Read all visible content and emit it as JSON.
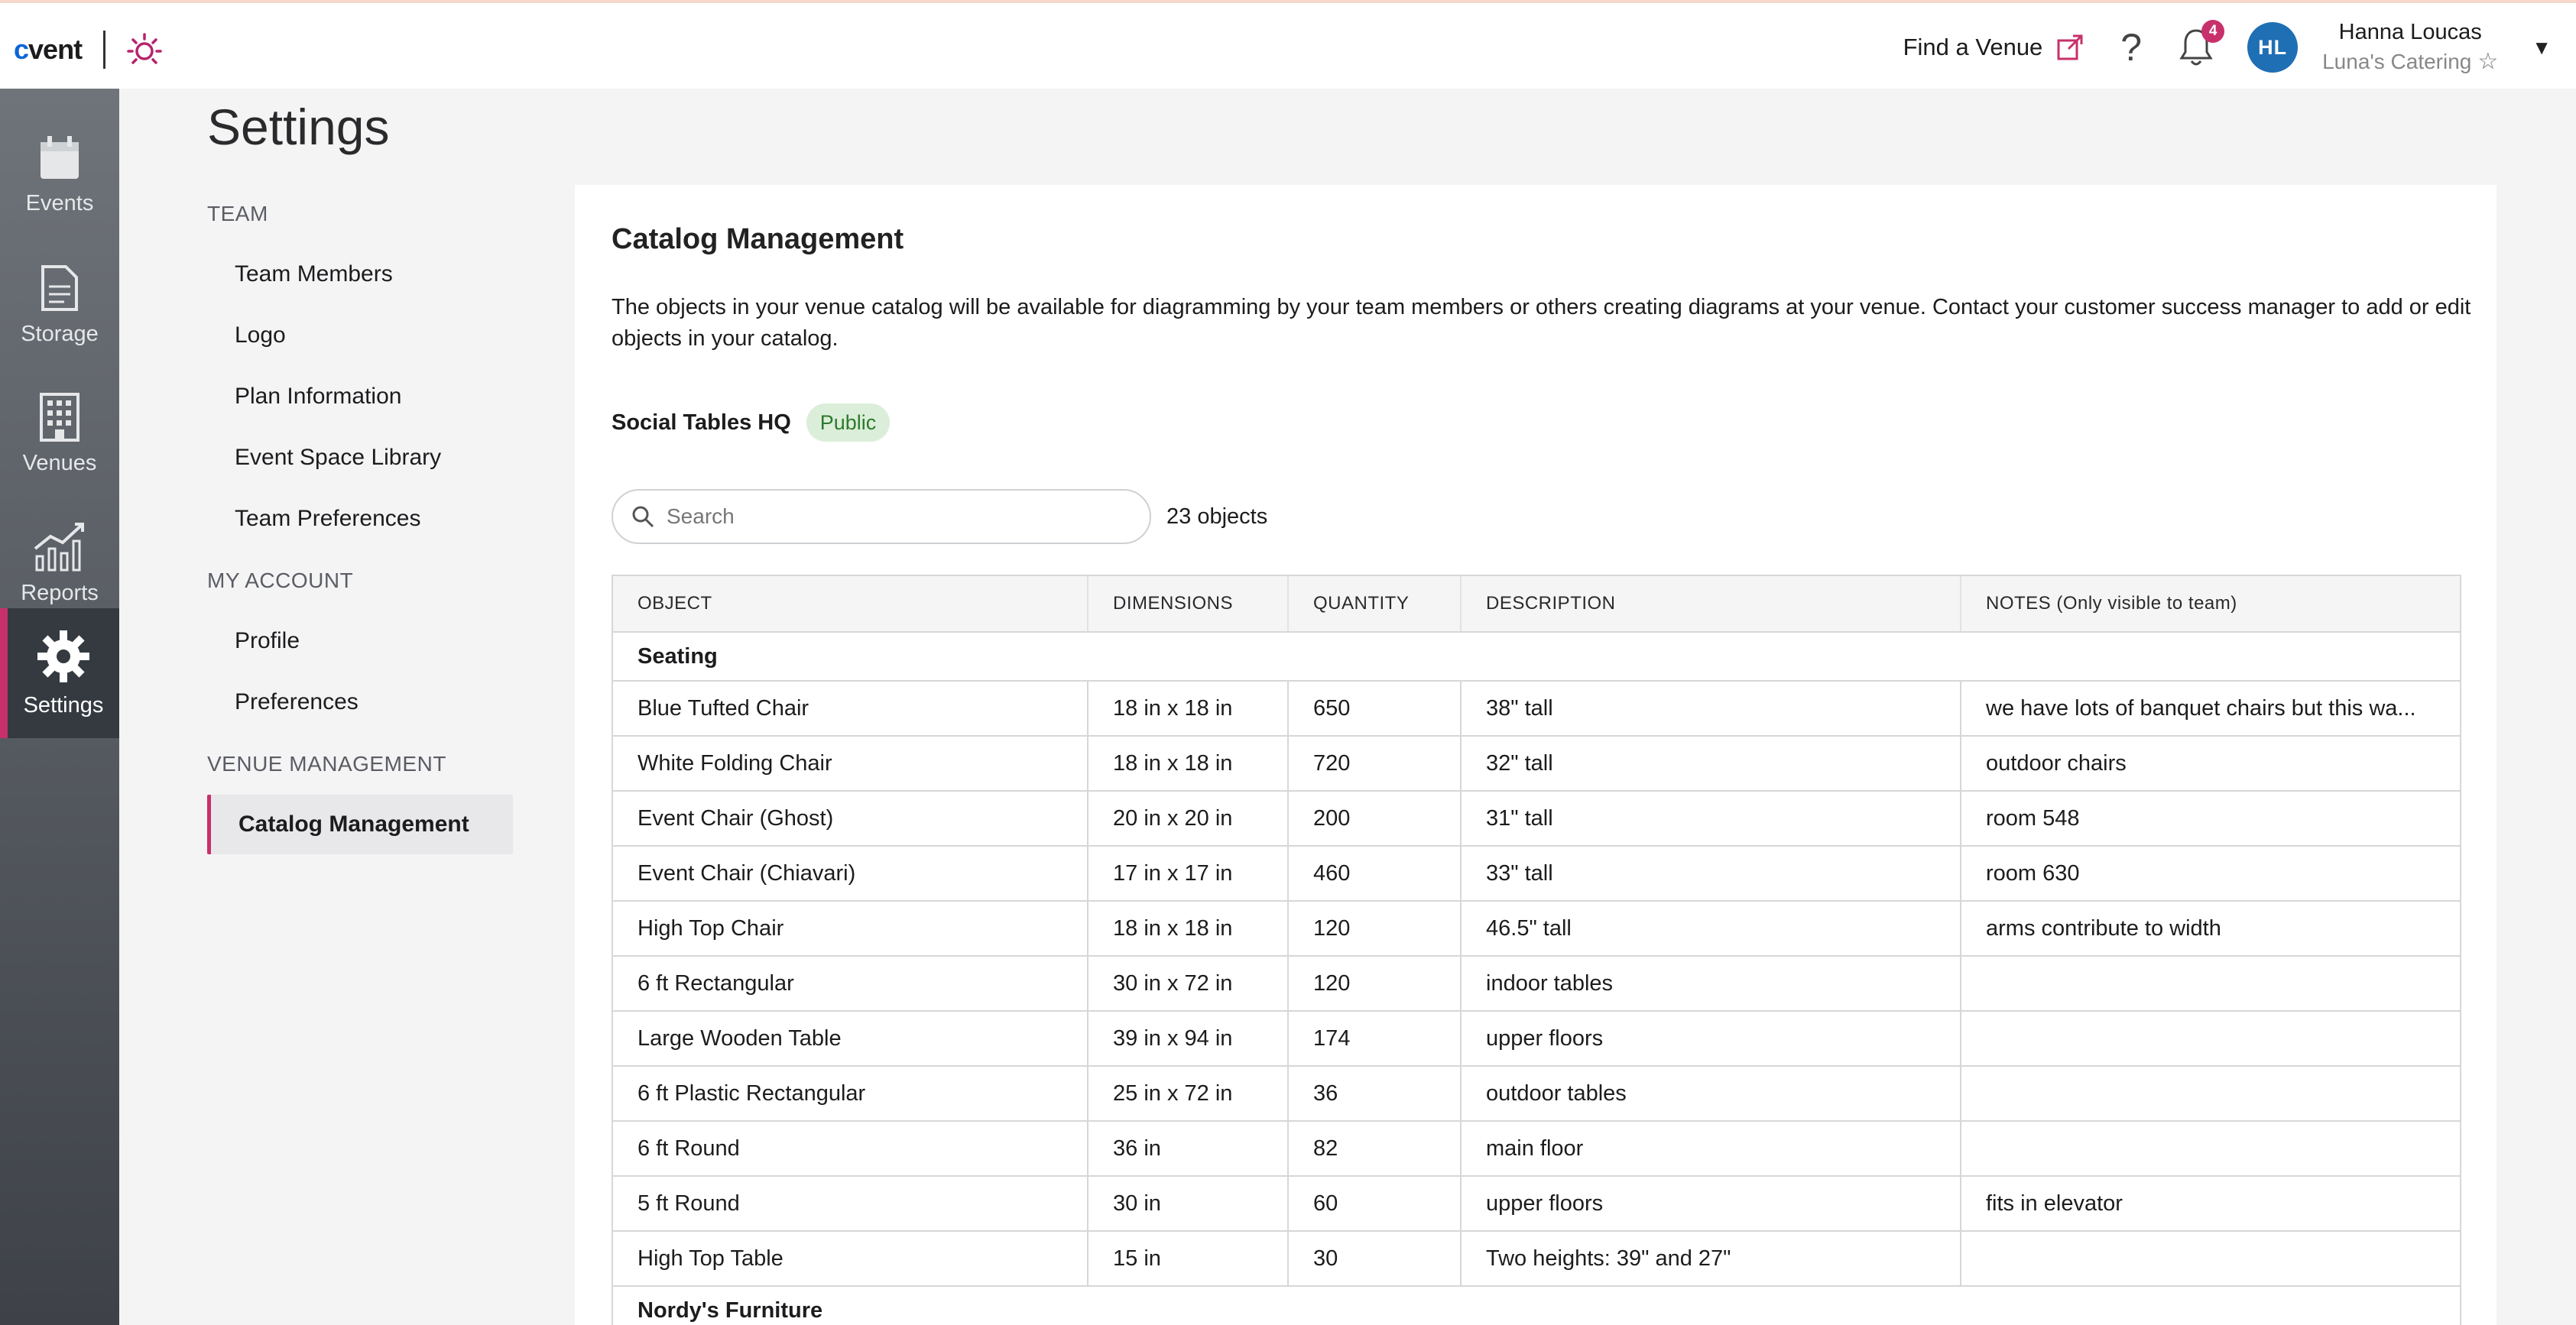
{
  "brand": {
    "logo_c": "c",
    "logo_rest": "vent",
    "accent": "#c8306b"
  },
  "header": {
    "find_venue": "Find a Venue",
    "help_icon": "?",
    "notifications_count": "4",
    "avatar_initials": "HL",
    "user_name": "Hanna Loucas",
    "user_org": "Luna's Catering"
  },
  "leftnav": {
    "items": [
      {
        "label": "Events",
        "icon": "calendar-icon"
      },
      {
        "label": "Storage",
        "icon": "document-icon"
      },
      {
        "label": "Venues",
        "icon": "building-icon"
      },
      {
        "label": "Reports",
        "icon": "chart-icon"
      },
      {
        "label": "Settings",
        "icon": "gear-icon",
        "active": true
      }
    ]
  },
  "settings": {
    "title": "Settings",
    "sections": [
      {
        "label": "TEAM",
        "items": [
          "Team Members",
          "Logo",
          "Plan Information",
          "Event Space Library",
          "Team Preferences"
        ]
      },
      {
        "label": "MY ACCOUNT",
        "items": [
          "Profile",
          "Preferences"
        ]
      },
      {
        "label": "VENUE MANAGEMENT",
        "items": [
          "Catalog Management"
        ]
      }
    ]
  },
  "catalog": {
    "title": "Catalog Management",
    "description": "The objects in your venue catalog will be available for diagramming by your team members or others creating diagrams at your venue. Contact your customer success manager to add or edit objects in your catalog.",
    "venue_name": "Social Tables HQ",
    "visibility": "Public",
    "search_placeholder": "Search",
    "object_count": "23 objects",
    "columns": [
      "OBJECT",
      "DIMENSIONS",
      "QUANTITY",
      "DESCRIPTION",
      "NOTES (Only visible to team)"
    ],
    "groups": [
      {
        "name": "Seating",
        "rows": [
          [
            "Blue Tufted Chair",
            "18 in x 18 in",
            "650",
            "38\" tall",
            "we have lots of banquet chairs but this wa..."
          ],
          [
            "White Folding Chair",
            "18 in x 18 in",
            "720",
            "32\" tall",
            "outdoor chairs"
          ],
          [
            "Event Chair (Ghost)",
            "20 in x 20 in",
            "200",
            "31\" tall",
            "room 548"
          ],
          [
            "Event Chair (Chiavari)",
            "17 in x 17 in",
            "460",
            "33\" tall",
            "room 630"
          ],
          [
            "High Top Chair",
            "18 in x 18 in",
            "120",
            "46.5\" tall",
            "arms contribute to width"
          ],
          [
            "6 ft Rectangular",
            "30 in x 72 in",
            "120",
            "indoor tables",
            ""
          ],
          [
            "Large Wooden Table",
            "39 in x 94 in",
            "174",
            "upper floors",
            ""
          ],
          [
            "6 ft Plastic Rectangular",
            "25 in x 72 in",
            "36",
            "outdoor tables",
            ""
          ],
          [
            "6 ft Round",
            "36 in",
            "82",
            "main floor",
            ""
          ],
          [
            "5 ft Round",
            "30 in",
            "60",
            "upper floors",
            "fits in elevator"
          ],
          [
            "High Top Table",
            "15 in",
            "30",
            "Two heights: 39\" and 27\"",
            ""
          ]
        ]
      },
      {
        "name": "Nordy's Furniture",
        "rows": []
      }
    ]
  }
}
